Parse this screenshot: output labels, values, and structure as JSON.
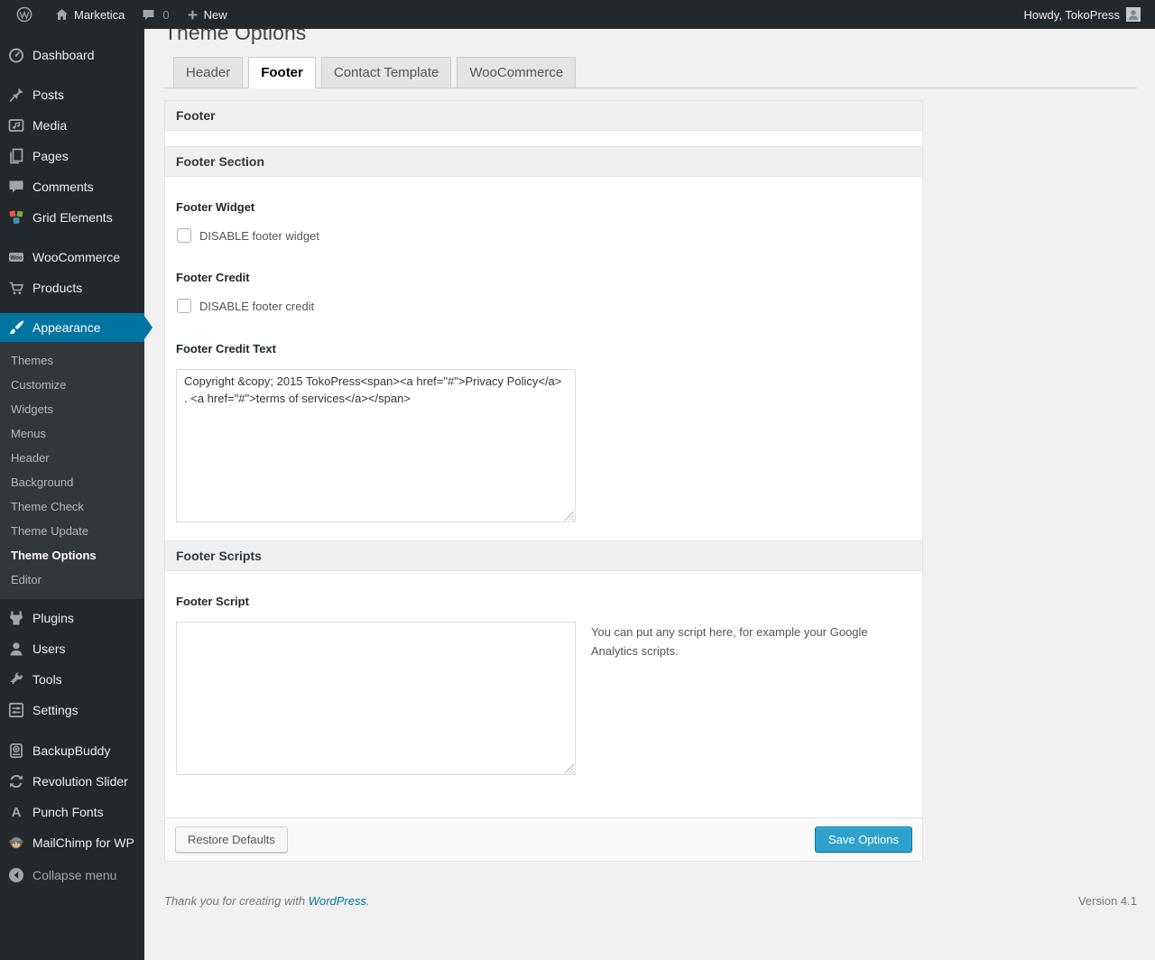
{
  "colors": {
    "accent": "#0074a2",
    "primary_button": "#2ea2cc",
    "admin_dark": "#23282d",
    "page_background": "#f1f1f1"
  },
  "admin_bar": {
    "site_name": "Marketica",
    "comment_count": "0",
    "new_label": "New",
    "howdy": "Howdy, TokoPress"
  },
  "sidebar": {
    "items": [
      {
        "label": "Dashboard",
        "icon": "dashboard-icon"
      },
      {
        "label": "Posts",
        "icon": "pin-icon"
      },
      {
        "label": "Media",
        "icon": "media-icon"
      },
      {
        "label": "Pages",
        "icon": "pages-icon"
      },
      {
        "label": "Comments",
        "icon": "comment-icon"
      },
      {
        "label": "Grid Elements",
        "icon": "grid-elements-icon"
      },
      {
        "label": "WooCommerce",
        "icon": "woocommerce-icon"
      },
      {
        "label": "Products",
        "icon": "cart-icon"
      },
      {
        "label": "Appearance",
        "icon": "appearance-brush-icon",
        "active": true
      },
      {
        "label": "Plugins",
        "icon": "plugin-icon"
      },
      {
        "label": "Users",
        "icon": "user-icon"
      },
      {
        "label": "Tools",
        "icon": "wrench-icon"
      },
      {
        "label": "Settings",
        "icon": "settings-icon"
      },
      {
        "label": "BackupBuddy",
        "icon": "backupbuddy-icon"
      },
      {
        "label": "Revolution Slider",
        "icon": "revolution-slider-icon"
      },
      {
        "label": "Punch Fonts",
        "icon": "letter-a-icon"
      },
      {
        "label": "MailChimp for WP",
        "icon": "mailchimp-icon"
      },
      {
        "label": "Collapse menu",
        "icon": "collapse-icon"
      }
    ],
    "appearance_submenu": [
      "Themes",
      "Customize",
      "Widgets",
      "Menus",
      "Header",
      "Background",
      "Theme Check",
      "Theme Update",
      "Theme Options",
      "Editor"
    ],
    "submenu_current": "Theme Options"
  },
  "main": {
    "title": "Theme Options",
    "tabs": [
      {
        "label": "Header",
        "active": false
      },
      {
        "label": "Footer",
        "active": true
      },
      {
        "label": "Contact Template",
        "active": false
      },
      {
        "label": "WooCommerce",
        "active": false
      }
    ],
    "panel": {
      "box_title": "Footer",
      "section_title": "Footer Section",
      "footer_widget": {
        "label": "Footer Widget",
        "checkbox_label": "DISABLE footer widget",
        "checked": false
      },
      "footer_credit": {
        "label": "Footer Credit",
        "checkbox_label": "DISABLE footer credit",
        "checked": false
      },
      "footer_credit_text": {
        "label": "Footer Credit Text",
        "value": "Copyright &copy; 2015 TokoPress<span><a href=\"#\">Privacy Policy</a> . <a href=\"#\">terms of services</a></span>"
      },
      "scripts_title": "Footer Scripts",
      "footer_script": {
        "label": "Footer Script",
        "value": "",
        "helper": "You can put any script here, for example your Google Analytics scripts."
      },
      "actions": {
        "restore_label": "Restore Defaults",
        "save_label": "Save Options"
      }
    }
  },
  "page_footer": {
    "thanks_text": "Thank you for creating with ",
    "link_label": "WordPress",
    "period": ".",
    "version": "Version 4.1"
  }
}
